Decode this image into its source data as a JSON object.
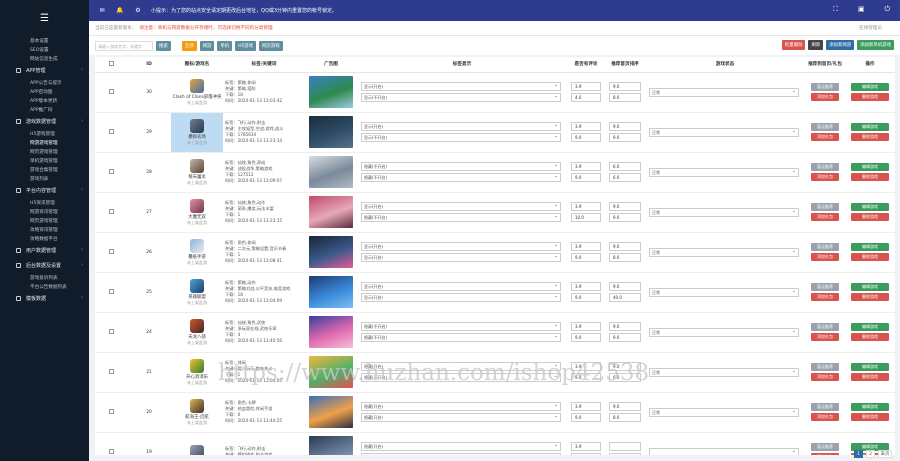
{
  "sidebar": {
    "menu_icon": "hamburger-icon",
    "pre_items": [
      "基本设置",
      "SEO设置",
      "网站信息生成"
    ],
    "groups": [
      {
        "label": "APP管理",
        "items": [
          "APP公告与提示",
          "APP启动图",
          "APP版本更新",
          "APP推广码"
        ]
      },
      {
        "label": "游戏数据管理",
        "items": [
          "H5游戏管理",
          "网游游戏管理",
          "网页游戏管理",
          "单机游戏管理",
          "游戏合集管理",
          "游戏列表"
        ]
      },
      {
        "label": "平台内容管理",
        "items": [
          "H5资讯管理",
          "网游资讯管理",
          "网页游戏管理",
          "攻略资讯管理",
          "攻略数据平台"
        ]
      },
      {
        "label": "用户数据管理",
        "items": []
      },
      {
        "label": "后台数据及设置",
        "items": [
          "游戏投诉列表",
          "平台公告数据列表"
        ]
      },
      {
        "label": "模板数据",
        "items": []
      }
    ]
  },
  "topbar": {
    "mail_icon": "mail-icon",
    "bell_icon": "bell-icon",
    "gear_icon": "gear-icon",
    "notice": "小提示：为了您的站点安全请定期更改后台地址，QQ或3分钟内重置您的帐号锁定。",
    "right_icons": [
      "fullscreen-icon",
      "user-icon",
      "power-icon"
    ]
  },
  "alert": {
    "text": "当前已是最新版本，",
    "warn": "请注意：单机与网游数据分开存储时，可选择切换不同的分类管理",
    "right": "在线管理员"
  },
  "toolbar": {
    "search_placeholder": "请输入游戏名字，关键字",
    "search_btn": "搜索",
    "filters": [
      "全部",
      "网游",
      "单机",
      "H5游戏",
      "网页游戏"
    ],
    "right_btns": [
      "批量删除",
      "刷新",
      "添加新网游",
      "添加新单机游戏"
    ]
  },
  "table": {
    "headers": [
      "",
      "ID",
      "图标/游戏名",
      "标签/关键词",
      "广告图",
      "标签显示",
      "是否有评论",
      "推荐首页排序",
      "游戏状态",
      "推荐到首页/礼包",
      "操作"
    ],
    "rows": [
      {
        "id": "30",
        "name": "Clash of Clans部落冲突",
        "sub": "未上架此游",
        "tags": [
          "标签：策略,休闲",
          "关键：策略,塔防",
          "下载：18",
          "时间：2024-01-13 13:03:42"
        ],
        "sel1": "显示(开启)",
        "sel2": "显示(不开启)",
        "v1": "3.9",
        "v2": "4.0",
        "v3": "9.0",
        "v4": "8.0",
        "status": "正常",
        "c1": "#e8a33b",
        "c2": "#3b6fb0",
        "t1": "#3a7fc1",
        "t2": "#2d8a4e",
        "t3": "#9fc8e6",
        "btn_a": "暂无推荐",
        "btn_b": "添加礼包",
        "edit": "编辑游戏",
        "del": "删除游戏"
      },
      {
        "id": "29",
        "name": "模拟农场",
        "sub": "未上架此游",
        "tags": [
          "标签：飞行,动作,射击",
          "关键：主攻轻型,空战,游戏,战斗",
          "下载：1785634",
          "时间：2024-01-13 13:23:14"
        ],
        "sel1": "显示(开启)",
        "sel2": "显示(不开启)",
        "v1": "3.9",
        "v2": "9.0",
        "v3": "9.0",
        "v4": "9.0",
        "status": "正常",
        "c1": "#6f7f91",
        "c2": "#2a3845",
        "t1": "#1a2c3b",
        "t2": "#2e4d66",
        "t3": "#5a7189",
        "btn_a": "暂无推荐",
        "btn_b": "添加礼包",
        "edit": "编辑游戏",
        "del": "删除游戏",
        "hl": true
      },
      {
        "id": "28",
        "name": "倚天屠龙",
        "sub": "未上架此游",
        "tags": [
          "标签：仙侠,角色,养成",
          "关键：战役战争,策略游戏",
          "下载：127512",
          "时间：2024-01-13 13:09:07"
        ],
        "sel1": "隐藏(不开启)",
        "sel2": "隐藏(不开启)",
        "v1": "3.9",
        "v2": "9.0",
        "v3": "6.0",
        "v4": "6.0",
        "status": "正常",
        "c1": "#c2b7a3",
        "c2": "#5a4636",
        "t1": "#d7dce2",
        "t2": "#7a8a9a",
        "t3": "#b0bac4",
        "btn_a": "暂无推荐",
        "btn_b": "添加礼包",
        "edit": "编辑游戏",
        "del": "删除游戏"
      },
      {
        "id": "27",
        "name": "大魔无双",
        "sub": "未上架此游",
        "tags": [
          "标签：仙侠,角色,动作",
          "关键：萌系,爆笑,玩法丰富",
          "下载：1",
          "时间：2024-01-13 13:23:15"
        ],
        "sel1": "显示(开启)",
        "sel2": "隐藏(不开启)",
        "v1": "3.9",
        "v2": "10.0",
        "v3": "9.0",
        "v4": "9.0",
        "status": "正常",
        "c1": "#e48fa0",
        "c2": "#6b3a4a",
        "t1": "#c24a6c",
        "t2": "#e6a8b8",
        "t3": "#5a2a3a",
        "btn_a": "暂无推荐",
        "btn_b": "添加礼包",
        "edit": "编辑游戏",
        "del": "删除游戏"
      },
      {
        "id": "26",
        "name": "叠纸手游",
        "sub": "未上架此游",
        "tags": [
          "标签：角色,休闲",
          "关键：二次元,策略设置,音乐节奏",
          "下载：1",
          "时间：2024-01-13 13:08:41"
        ],
        "sel1": "显示(开启)",
        "sel2": "显示(开启)",
        "v1": "3.9",
        "v2": "9.0",
        "v3": "9.0",
        "v4": "8.0",
        "status": "正常",
        "c1": "#8fb1d9",
        "c2": "#e9eef5",
        "t1": "#1a2335",
        "t2": "#3a5a8a",
        "t3": "#e85a9a",
        "btn_a": "暂无推荐",
        "btn_b": "添加礼包",
        "edit": "编辑游戏",
        "del": "删除游戏"
      },
      {
        "id": "25",
        "name": "英雄联盟",
        "sub": "未上架此游",
        "tags": [
          "标签：策略,动作",
          "关键：策略对战,公平竞技,电竞游戏",
          "下载：18",
          "时间：2024-01-13 13:04:09"
        ],
        "sel1": "显示(开启)",
        "sel2": "显示(开启)",
        "v1": "3.9",
        "v2": "9.0",
        "v3": "9.0",
        "v4": "40.0",
        "status": "正常",
        "c1": "#4aa3d9",
        "c2": "#1d3e6b",
        "t1": "#1e3b73",
        "t2": "#3a8ad9",
        "t3": "#7ac0f0",
        "btn_a": "暂无推荐",
        "btn_b": "添加礼包",
        "edit": "编辑游戏",
        "del": "删除游戏"
      },
      {
        "id": "24",
        "name": "天龙八部",
        "sub": "未上架此游",
        "tags": [
          "标签：仙侠,角色,武侠",
          "关键：多玩家在线,武侠乐章",
          "下载：4",
          "时间：2024-01-13 13:40:56"
        ],
        "sel1": "隐藏(不开启)",
        "sel2": "隐藏(不开启)",
        "v1": "3.9",
        "v2": "9.0",
        "v3": "9.0",
        "v4": "9.0",
        "status": "正常",
        "c1": "#d9552a",
        "c2": "#3a2a2a",
        "t1": "#3a3f9a",
        "t2": "#e26ab0",
        "t3": "#f0c0d8",
        "btn_a": "暂无推荐",
        "btn_b": "添加礼包",
        "edit": "编辑游戏",
        "del": "删除游戏"
      },
      {
        "id": "21",
        "name": "开心消消乐",
        "sub": "未上架此游",
        "tags": [
          "标签：休闲",
          "关键：婴儿玩乐,趣味关卡",
          "下载：1",
          "时间：2024-01-13 13:04:05"
        ],
        "sel1": "隐藏(开启)",
        "sel2": "隐藏(不开启)",
        "v1": "3.9",
        "v2": "9.0",
        "v3": "9.0",
        "v4": "6.0",
        "status": "正常",
        "c1": "#f2c230",
        "c2": "#2e7d32",
        "t1": "#f4b63a",
        "t2": "#4fb06a",
        "t3": "#e35050",
        "btn_a": "暂无推荐",
        "btn_b": "添加礼包",
        "edit": "编辑游戏",
        "del": "删除游戏"
      },
      {
        "id": "20",
        "name": "航海王-启航",
        "sub": "未上架此游",
        "tags": [
          "标签：角色,卡牌",
          "关键：热血冒险,休闲手游",
          "下载：0",
          "时间：2024-01-13 13:44:25"
        ],
        "sel1": "隐藏(开启)",
        "sel2": "隐藏(开启)",
        "v1": "3.9",
        "v2": "9.0",
        "v3": "9.0",
        "v4": "8.0",
        "status": "正常",
        "c1": "#e2b453",
        "c2": "#3a2f2a",
        "t1": "#3a6fb8",
        "t2": "#f0a04a",
        "t3": "#2a3040",
        "btn_a": "暂无推荐",
        "btn_b": "添加礼包",
        "edit": "编辑游戏",
        "del": "删除游戏"
      },
      {
        "id": "19",
        "name": "",
        "sub": "",
        "tags": [
          "标签：飞行,动作,射击",
          "关键：模拟操作,射击游戏",
          ""
        ],
        "sel1": "隐藏(开启)",
        "sel2": "",
        "v1": "3.9",
        "v2": "9.0",
        "v3": "",
        "v4": "",
        "status": "",
        "c1": "#9aa6b4",
        "c2": "#3a4556",
        "t1": "#2a3a55",
        "t2": "#6a7f9a",
        "t3": "#aab4c4",
        "btn_a": "暂无推荐",
        "btn_b": "添加礼包",
        "edit": "编辑游戏",
        "del": "删除游戏"
      }
    ]
  },
  "watermark": "https://www.huzhan.com/ishop42538",
  "pager": {
    "pages": [
      "1",
      "2"
    ],
    "next": "末页"
  }
}
